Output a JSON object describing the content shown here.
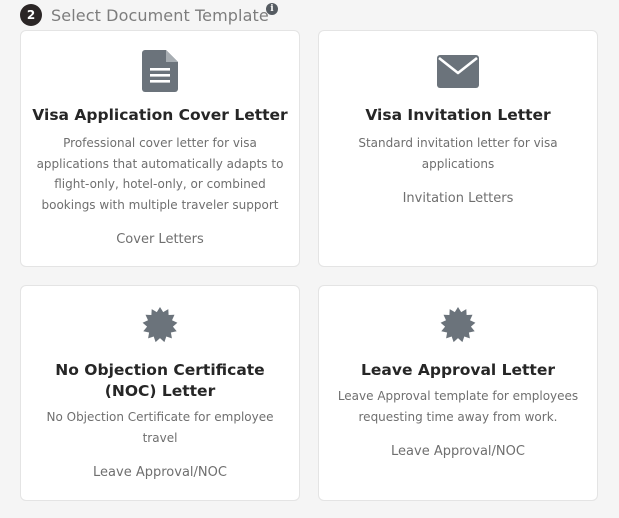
{
  "header": {
    "step_number": "2",
    "title": "Select Document Template",
    "info_glyph": "i"
  },
  "templates": [
    {
      "icon": "document-icon",
      "title": "Visa Application Cover Letter",
      "description": "Professional cover letter for visa applications that automatically adapts to flight-only, hotel-only, or combined bookings with multiple traveler support",
      "category": "Cover Letters"
    },
    {
      "icon": "envelope-icon",
      "title": "Visa Invitation Letter",
      "description": "Standard invitation letter for visa applications",
      "category": "Invitation Letters"
    },
    {
      "icon": "certificate-icon",
      "title": "No Objection Certificate (NOC) Letter",
      "description": "No Objection Certificate for employee travel",
      "category": "Leave Approval/NOC"
    },
    {
      "icon": "certificate-icon",
      "title": "Leave Approval Letter",
      "description": "Leave Approval template for employees requesting time away from work.",
      "category": "Leave Approval/NOC"
    }
  ],
  "colors": {
    "icon": "#6b737b",
    "badge": "#2b2626",
    "background": "#f5f5f5"
  }
}
